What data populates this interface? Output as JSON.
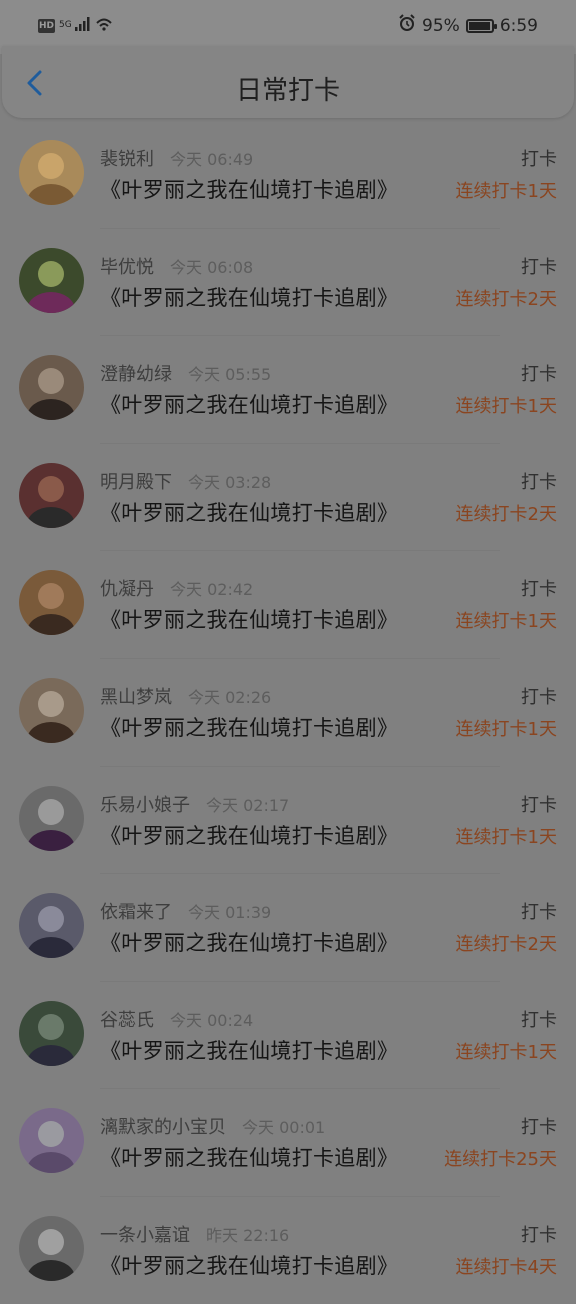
{
  "status_bar": {
    "hd": "HD",
    "network": "5G",
    "battery_level": 0.95,
    "battery": "95%",
    "time": "6:59",
    "icons": [
      "hd-icon",
      "signal-icon",
      "wifi-icon",
      "alarm-icon",
      "battery-icon"
    ]
  },
  "header": {
    "title": "日常打卡",
    "back_icon": "chevron-left-icon"
  },
  "records": [
    {
      "name": "裴锐利",
      "time": "今天 06:49",
      "title": "《叶罗丽之我在仙境打卡追剧》",
      "action": "打卡",
      "streak": "连续打卡1天"
    },
    {
      "name": "毕优悦",
      "time": "今天 06:08",
      "title": "《叶罗丽之我在仙境打卡追剧》",
      "action": "打卡",
      "streak": "连续打卡2天"
    },
    {
      "name": "澄静幼绿",
      "time": "今天 05:55",
      "title": "《叶罗丽之我在仙境打卡追剧》",
      "action": "打卡",
      "streak": "连续打卡1天"
    },
    {
      "name": "明月殿下",
      "time": "今天 03:28",
      "title": "《叶罗丽之我在仙境打卡追剧》",
      "action": "打卡",
      "streak": "连续打卡2天"
    },
    {
      "name": "仇凝丹",
      "time": "今天 02:42",
      "title": "《叶罗丽之我在仙境打卡追剧》",
      "action": "打卡",
      "streak": "连续打卡1天"
    },
    {
      "name": "黑山梦岚",
      "time": "今天 02:26",
      "title": "《叶罗丽之我在仙境打卡追剧》",
      "action": "打卡",
      "streak": "连续打卡1天"
    },
    {
      "name": "乐易小娘子",
      "time": "今天 02:17",
      "title": "《叶罗丽之我在仙境打卡追剧》",
      "action": "打卡",
      "streak": "连续打卡1天"
    },
    {
      "name": "依霜来了",
      "time": "今天 01:39",
      "title": "《叶罗丽之我在仙境打卡追剧》",
      "action": "打卡",
      "streak": "连续打卡2天"
    },
    {
      "name": "谷蕊氏",
      "time": "今天 00:24",
      "title": "《叶罗丽之我在仙境打卡追剧》",
      "action": "打卡",
      "streak": "连续打卡1天"
    },
    {
      "name": "漓默家的小宝贝",
      "time": "今天 00:01",
      "title": "《叶罗丽之我在仙境打卡追剧》",
      "action": "打卡",
      "streak": "连续打卡25天"
    },
    {
      "name": "一条小嘉谊",
      "time": "昨天 22:16",
      "title": "《叶罗丽之我在仙境打卡追剧》",
      "action": "打卡",
      "streak": "连续打卡4天"
    }
  ],
  "avatar_colors": [
    [
      "#a98a5a",
      "#7a5a34",
      "#c9a46a"
    ],
    [
      "#3c4a2c",
      "#6e2a5a",
      "#8a9a5a"
    ],
    [
      "#6a5a4c",
      "#2c2420",
      "#9a8a7a"
    ],
    [
      "#5a3030",
      "#2a2a2a",
      "#8a5a4a"
    ],
    [
      "#7a5a3a",
      "#3a2a20",
      "#a07a5a"
    ],
    [
      "#7a6a5a",
      "#3a2a20",
      "#a89a8a"
    ],
    [
      "#6a6a6a",
      "#3a2040",
      "#9a9a9a"
    ],
    [
      "#5a5a6a",
      "#2a2a3a",
      "#8a8a9a"
    ],
    [
      "#3a4a3a",
      "#2a2a3a",
      "#6a7a6a"
    ],
    [
      "#7a6a8a",
      "#5a4a6a",
      "#9a9aa0"
    ],
    [
      "#6a6a6a",
      "#2a2a2a",
      "#a0a0a0"
    ]
  ]
}
